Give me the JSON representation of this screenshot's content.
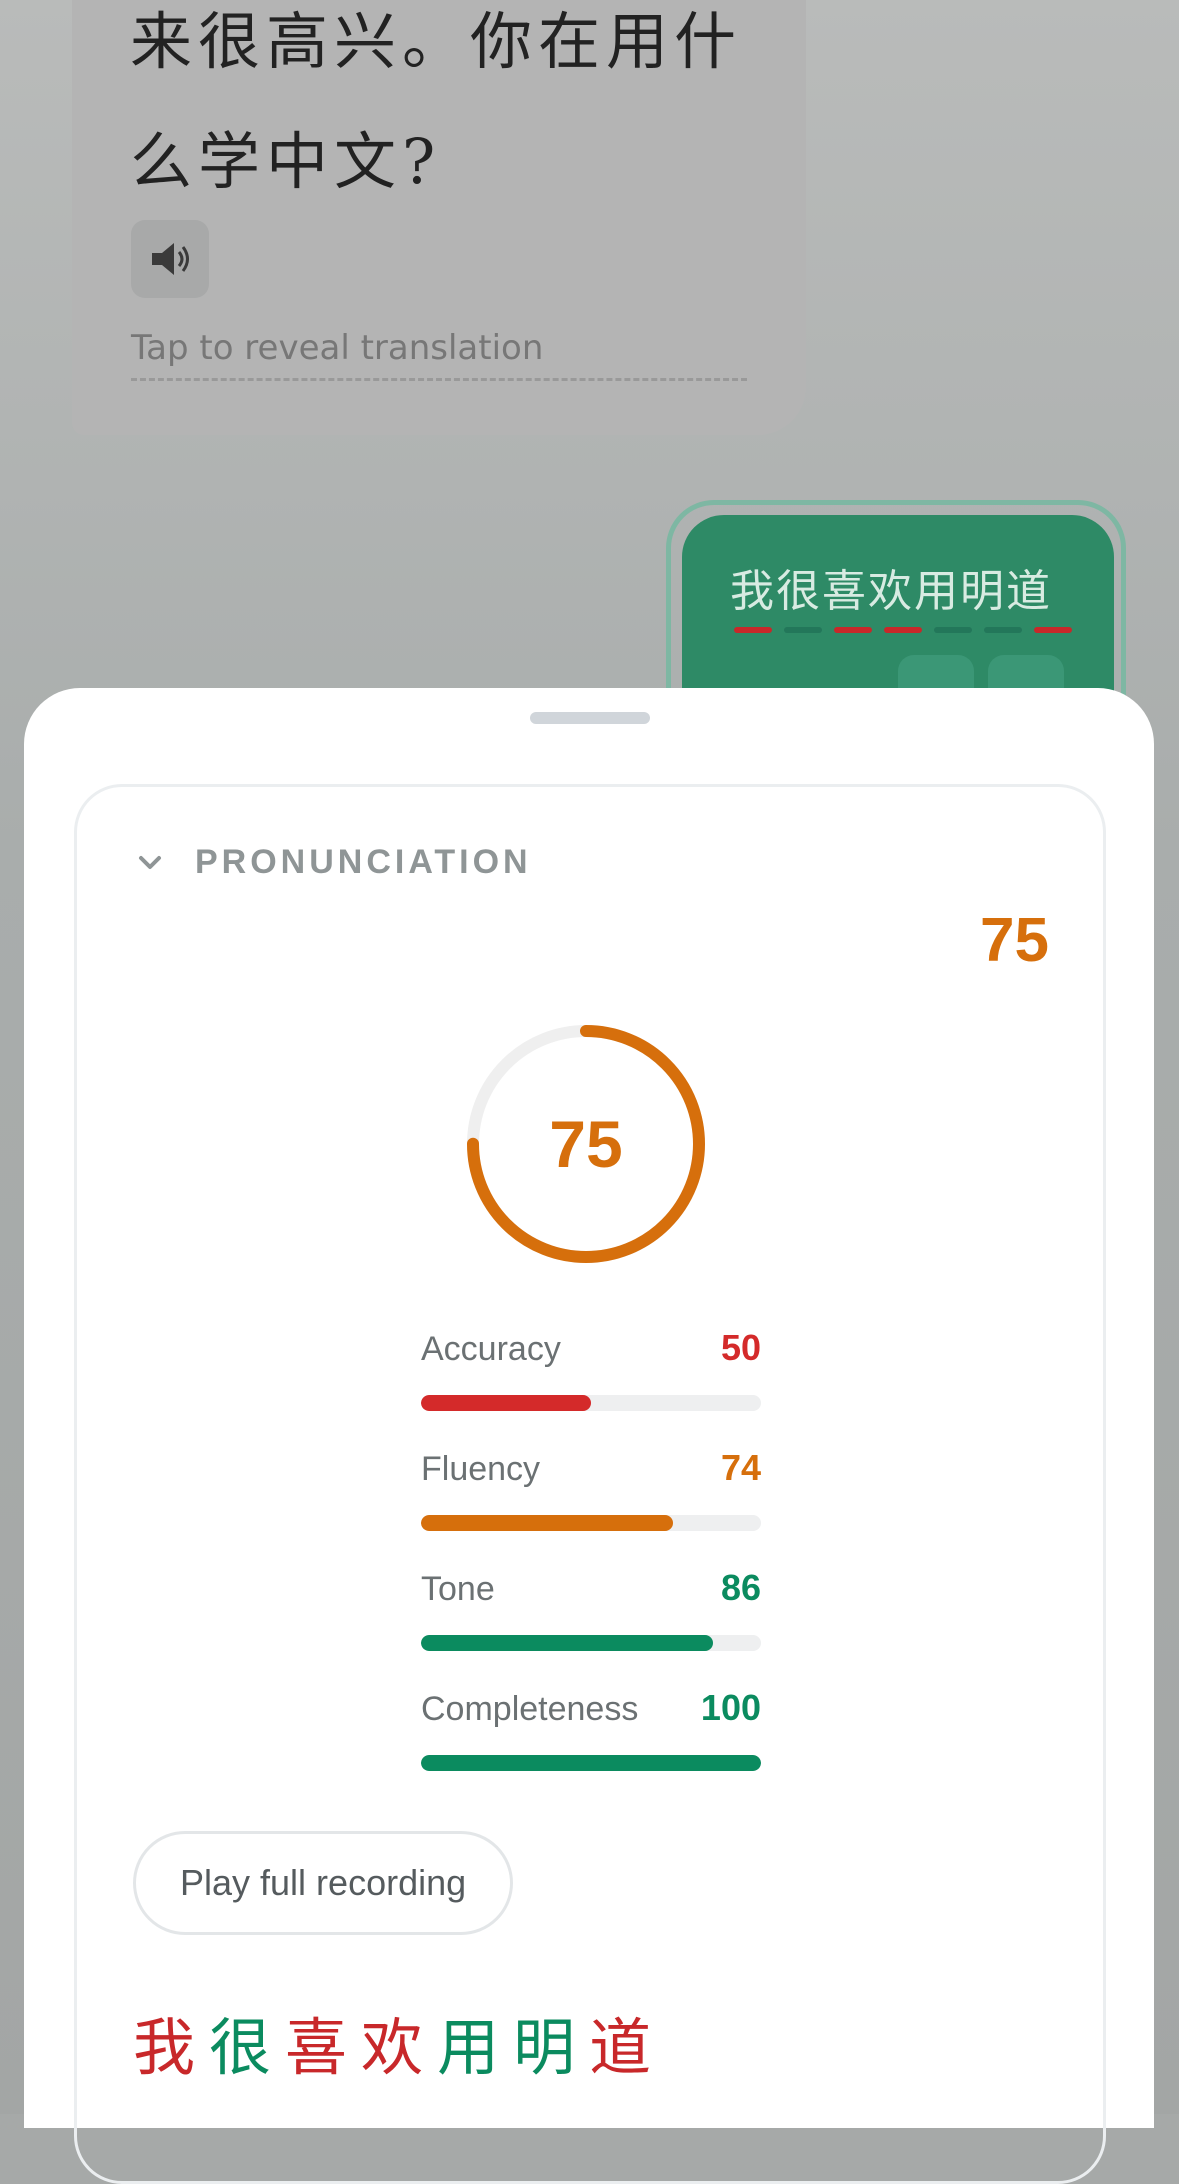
{
  "chat": {
    "bot_message": "来很高兴。你在用什么学中文?",
    "reveal_hint": "Tap to reveal translation",
    "user_message": "我很喜欢用明道",
    "user_char_status": [
      "bad",
      "good",
      "bad",
      "bad",
      "good",
      "good",
      "bad"
    ]
  },
  "pronunciation": {
    "section_title": "PRONUNCIATION",
    "overall_score": "75",
    "ring_score": "75",
    "ring_fraction": 0.75,
    "metrics": [
      {
        "label": "Accuracy",
        "value": "50",
        "fraction": 0.5,
        "color": "#d42a2a"
      },
      {
        "label": "Fluency",
        "value": "74",
        "fraction": 0.74,
        "color": "#d66f0c"
      },
      {
        "label": "Tone",
        "value": "86",
        "fraction": 0.86,
        "color": "#0b8b5f"
      },
      {
        "label": "Completeness",
        "value": "100",
        "fraction": 1.0,
        "color": "#0b8b5f"
      }
    ],
    "play_button_label": "Play full recording",
    "characters": [
      {
        "char": "我",
        "color": "#c8282a"
      },
      {
        "char": "很",
        "color": "#0b8b5f"
      },
      {
        "char": "喜",
        "color": "#c8282a"
      },
      {
        "char": "欢",
        "color": "#c8282a"
      },
      {
        "char": "用",
        "color": "#0b8b5f"
      },
      {
        "char": "明",
        "color": "#0b8b5f"
      },
      {
        "char": "道",
        "color": "#c8282a"
      }
    ]
  },
  "colors": {
    "accent_orange": "#d66f0c",
    "good": "#0b8b5f",
    "bad": "#c8282a"
  },
  "icons": {
    "speaker": "speaker-icon",
    "chevron": "chevron-down-icon"
  }
}
